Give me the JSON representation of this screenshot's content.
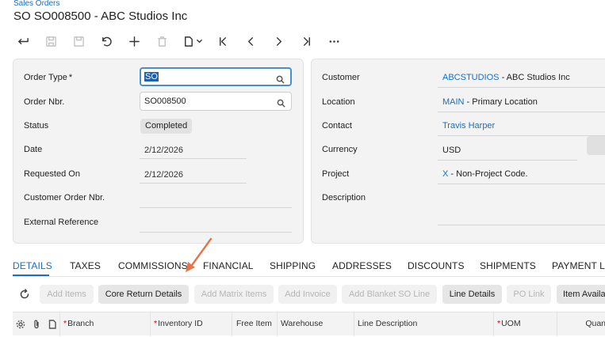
{
  "breadcrumb": "Sales Orders",
  "page_title": "SO SO008500 - ABC Studios Inc",
  "toolbar": {
    "buttons": [
      {
        "icon": "back-icon",
        "enabled": true
      },
      {
        "icon": "save-close-icon",
        "enabled": false
      },
      {
        "icon": "save-icon",
        "enabled": false
      },
      {
        "icon": "undo-icon",
        "enabled": true
      },
      {
        "icon": "add-icon",
        "enabled": true
      },
      {
        "icon": "delete-icon",
        "enabled": false
      },
      {
        "icon": "copy-paste-icon",
        "enabled": true
      },
      {
        "icon": "first-record-icon",
        "enabled": true
      },
      {
        "icon": "previous-record-icon",
        "enabled": true
      },
      {
        "icon": "next-record-icon",
        "enabled": true
      },
      {
        "icon": "last-record-icon",
        "enabled": true
      },
      {
        "icon": "more-icon",
        "enabled": true
      }
    ]
  },
  "summary_left": {
    "order_type": {
      "label": "Order Type",
      "required_mark": "*",
      "value": "SO"
    },
    "order_nbr": {
      "label": "Order Nbr.",
      "value": "SO008500"
    },
    "status": {
      "label": "Status",
      "value": "Completed"
    },
    "date": {
      "label": "Date",
      "value": "2/12/2026"
    },
    "requested_on": {
      "label": "Requested On",
      "value": "2/12/2026"
    },
    "customer_order_nbr": {
      "label": "Customer Order Nbr.",
      "value": ""
    },
    "external_reference": {
      "label": "External Reference",
      "value": ""
    }
  },
  "summary_right": {
    "customer": {
      "label": "Customer",
      "link": "ABCSTUDIOS",
      "text": " - ABC Studios Inc"
    },
    "location": {
      "label": "Location",
      "link": "MAIN",
      "text": " - Primary Location"
    },
    "contact": {
      "label": "Contact",
      "link": "Travis Harper"
    },
    "currency": {
      "label": "Currency",
      "value": "USD"
    },
    "project": {
      "label": "Project",
      "link": "X",
      "text": " - Non-Project Code."
    },
    "description": {
      "label": "Description",
      "value": ""
    }
  },
  "tabs": [
    "DETAILS",
    "TAXES",
    "COMMISSIONS",
    "FINANCIAL",
    "SHIPPING",
    "ADDRESSES",
    "DISCOUNTS",
    "SHIPMENTS",
    "PAYMENT LI"
  ],
  "active_tab": "DETAILS",
  "grid_toolbar": [
    {
      "label": "Add Items",
      "enabled": false
    },
    {
      "label": "Core Return Details",
      "enabled": true
    },
    {
      "label": "Add Matrix Items",
      "enabled": false
    },
    {
      "label": "Add Invoice",
      "enabled": false
    },
    {
      "label": "Add Blanket SO Line",
      "enabled": false
    },
    {
      "label": "Line Details",
      "enabled": true
    },
    {
      "label": "PO Link",
      "enabled": false
    },
    {
      "label": "Item Availa",
      "enabled": true
    }
  ],
  "grid_columns": {
    "branch": {
      "label": "Branch",
      "required": "*"
    },
    "inventory_id": {
      "label": "Inventory ID",
      "required": "*"
    },
    "free_item": {
      "label": "Free Item"
    },
    "warehouse": {
      "label": "Warehouse"
    },
    "line_description": {
      "label": "Line Description"
    },
    "uom": {
      "label": "UOM",
      "required": "*"
    },
    "quantity": {
      "label": "Quan"
    }
  },
  "colors": {
    "accent": "#1b6ec2",
    "annotation_arrow": "#e8734a",
    "required": "#d0021b"
  }
}
